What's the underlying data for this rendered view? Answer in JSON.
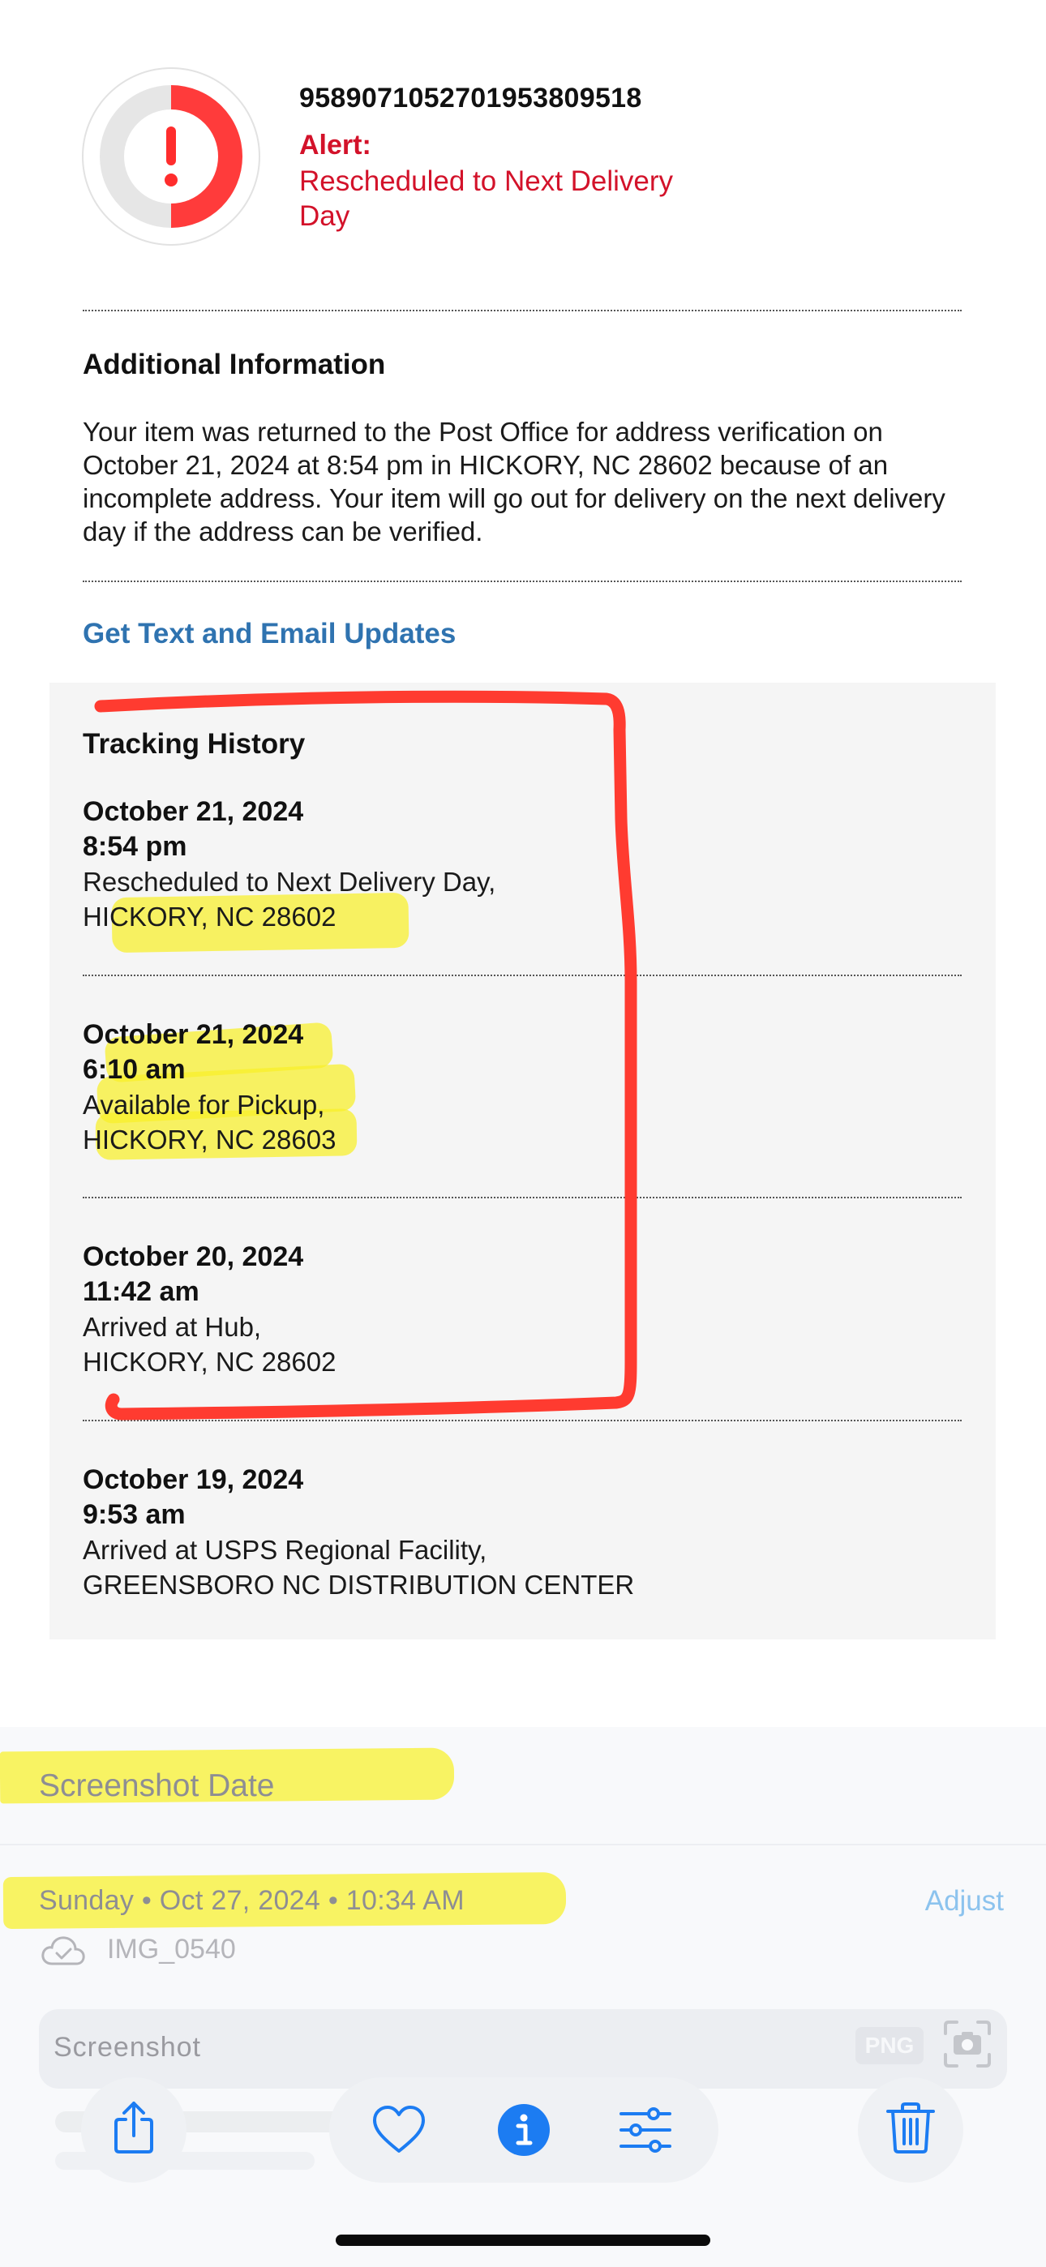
{
  "package": {
    "tracking_number": "9589071052701953809518",
    "alert_label": "Alert:",
    "alert_status": "Rescheduled to Next Delivery Day",
    "alert_color": "#d3122a"
  },
  "additional_info": {
    "title": "Additional Information",
    "body": "Your item was returned to the Post Office for address verification on October 21, 2024 at 8:54 pm in HICKORY, NC 28602 because of an incomplete address. Your item will go out for delivery on the next delivery day if the address can be verified."
  },
  "updates_link": "Get Text and Email Updates",
  "tracking_history": {
    "title": "Tracking History",
    "events": [
      {
        "date": "October 21, 2024",
        "time": "8:54 pm",
        "status": "Rescheduled to Next Delivery Day,",
        "location": "HICKORY, NC 28602"
      },
      {
        "date": "October 21, 2024",
        "time": "6:10 am",
        "status": "Available for Pickup,",
        "location": "HICKORY, NC 28603"
      },
      {
        "date": "October 20, 2024",
        "time": "11:42 am",
        "status": "Arrived at Hub,",
        "location": "HICKORY, NC 28602"
      },
      {
        "date": "October 19, 2024",
        "time": "9:53 am",
        "status": "Arrived at USPS Regional Facility,",
        "location": "GREENSBORO NC DISTRIBUTION CENTER"
      }
    ]
  },
  "photo_info": {
    "heading": "Screenshot Date",
    "date_line": "Sunday • Oct 27, 2024 • 10:34 AM",
    "adjust_label": "Adjust",
    "filename": "IMG_0540",
    "file_type": "Screenshot",
    "format_badge": "PNG"
  },
  "toolbar": {
    "icons": [
      "share-icon",
      "heart-icon",
      "info-icon",
      "adjust-sliders-icon",
      "trash-icon"
    ],
    "accent_color": "#1c7cf2"
  },
  "annotation_colors": {
    "red_marker": "#ff3b30",
    "yellow_highlighter": "#f8f028"
  }
}
